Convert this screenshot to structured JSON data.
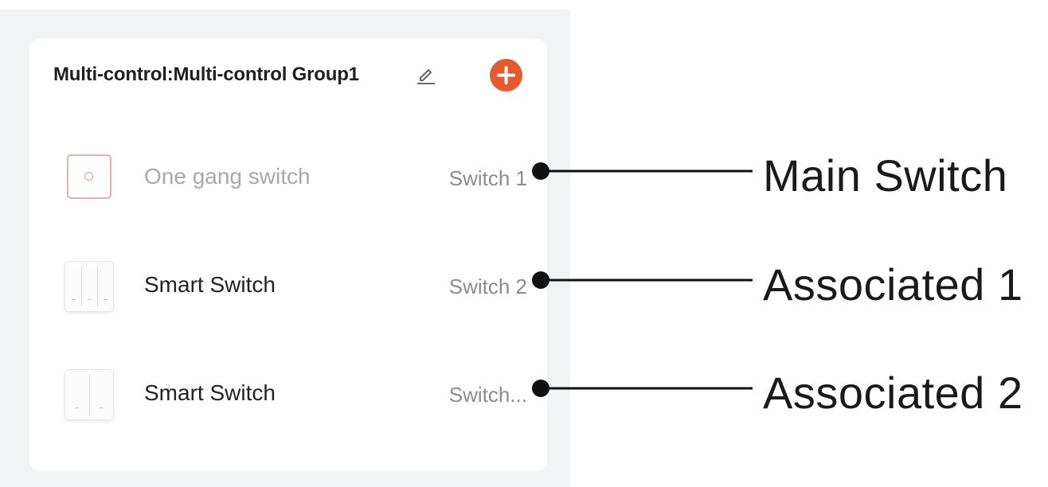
{
  "group": {
    "title": "Multi-control:Multi-control Group1"
  },
  "devices": [
    {
      "name": "One gang switch",
      "channel": "Switch 1",
      "icon": "one-gang-switch-icon"
    },
    {
      "name": "Smart Switch",
      "channel": "Switch 2",
      "icon": "three-gang-switch-icon"
    },
    {
      "name": "Smart Switch",
      "channel": "Switch...",
      "icon": "two-gang-switch-icon"
    }
  ],
  "callouts": [
    "Main Switch",
    "Associated 1",
    "Associated 2"
  ],
  "colors": {
    "accent": "#e5592c",
    "background": "#f2f3f5",
    "card": "#ffffff"
  }
}
